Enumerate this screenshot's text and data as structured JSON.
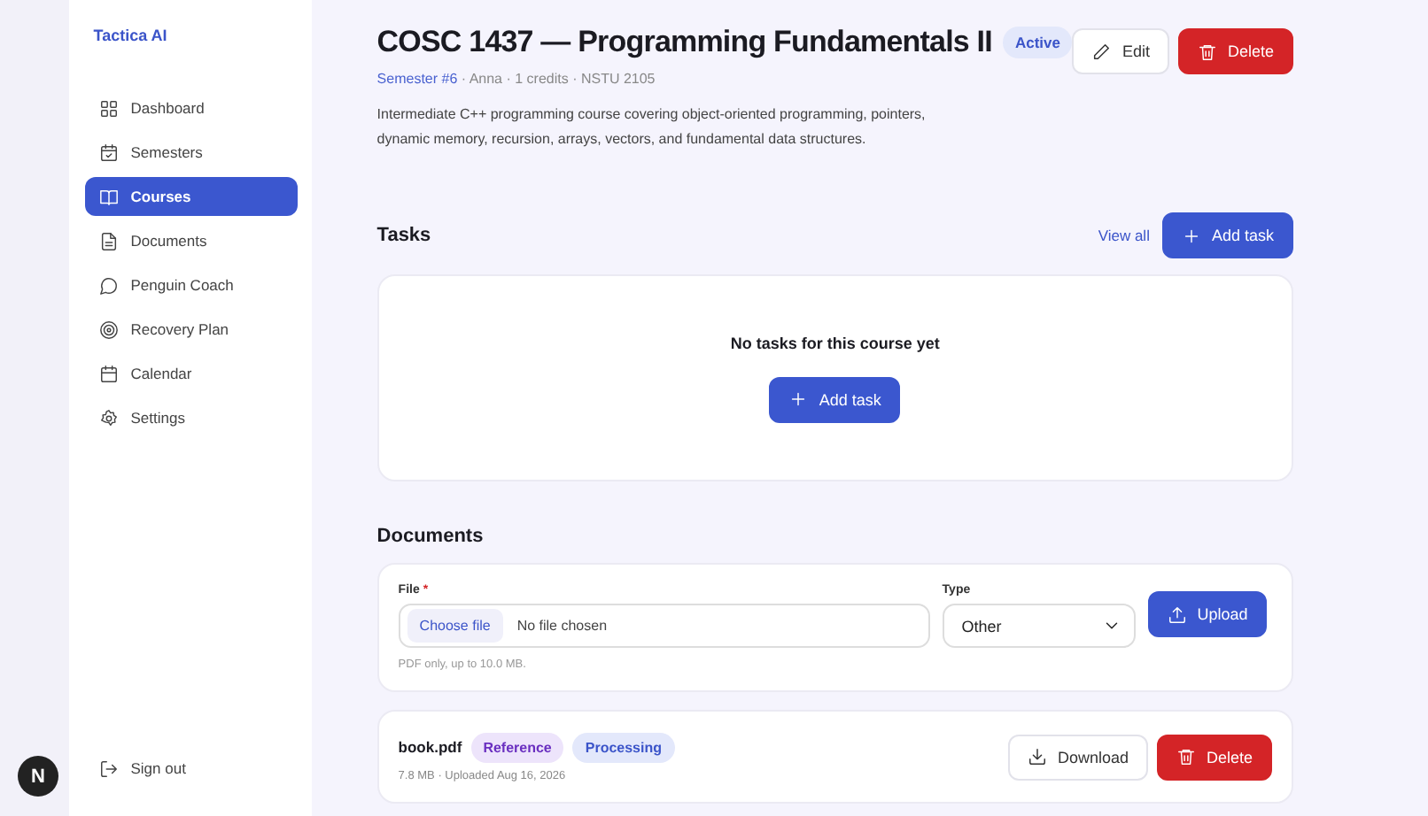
{
  "sidebar": {
    "brand": "Tactica AI",
    "items": [
      {
        "label": "Dashboard",
        "selected": false
      },
      {
        "label": "Semesters",
        "selected": false
      },
      {
        "label": "Courses",
        "selected": true
      },
      {
        "label": "Documents",
        "selected": false
      },
      {
        "label": "Penguin Coach",
        "selected": false
      },
      {
        "label": "Recovery Plan",
        "selected": false
      },
      {
        "label": "Calendar",
        "selected": false
      },
      {
        "label": "Settings",
        "selected": false
      }
    ],
    "sign_out": "Sign out"
  },
  "dev_badge": "N",
  "course": {
    "title": "COSC 1437 — Programming Fundamentals II",
    "status": "Active",
    "semester_link": "Semester #6",
    "meta": " · Anna · 1 credits · NSTU 2105",
    "description": "Intermediate C++ programming course covering object-oriented programming, pointers, dynamic memory, recursion, arrays, vectors, and fundamental data structures.",
    "buttons": [
      {
        "label": "Edit",
        "kind": "edit"
      },
      {
        "label": "Delete",
        "kind": "delete"
      }
    ]
  },
  "tasks": {
    "heading": "Tasks",
    "view_all": "View all",
    "add_button": "Add task",
    "empty_text": "No tasks for this course yet",
    "empty_button": "Add task"
  },
  "documents": {
    "heading": "Documents",
    "upload": {
      "file_label": "File",
      "required_mark": "*",
      "choose_button": "Choose file",
      "file_status": "No file chosen",
      "hint": "PDF only, up to 10.0 MB.",
      "type_label": "Type",
      "type_value": "Other",
      "upload_button": "Upload"
    },
    "files": [
      {
        "name": "book.pdf",
        "tags": [
          {
            "label": "Reference",
            "color": "#ede4fb"
          },
          {
            "label": "Processing",
            "color": "#e3e8fb"
          }
        ],
        "meta": "7.8 MB · Uploaded Aug 16, 2026",
        "download": "Download",
        "delete": "Delete"
      }
    ]
  }
}
